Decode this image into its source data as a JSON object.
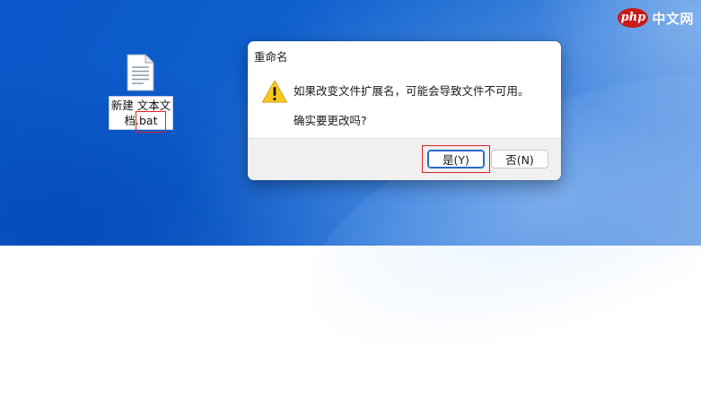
{
  "watermark": {
    "logo_text": "php",
    "site_text": "中文网"
  },
  "desktop": {
    "file": {
      "icon": "text-document-icon",
      "label_line1": "新建 文本文",
      "label_line2_prefix": "档",
      "label_line2_ext": ".bat"
    }
  },
  "dialog": {
    "title": "重命名",
    "icon": "warning-icon",
    "message": "如果改变文件扩展名，可能会导致文件不可用。",
    "question": "确实要更改吗?",
    "buttons": {
      "yes": "是(Y)",
      "no": "否(N)"
    }
  },
  "colors": {
    "highlight": "#e02020",
    "default_button_border": "#2c69c7",
    "warning_yellow": "#f8c81e"
  }
}
